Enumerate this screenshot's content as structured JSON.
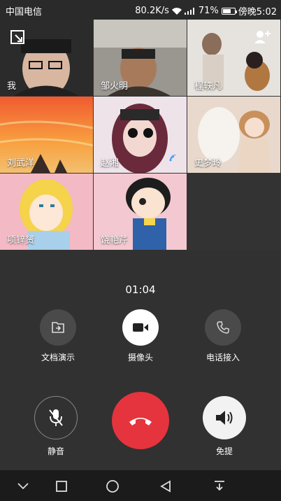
{
  "status": {
    "carrier": "中国电信",
    "speed": "80.2K/s",
    "battery_pct": "71%",
    "time": "傍晚5:02",
    "battery_level": 0.71
  },
  "participants": [
    {
      "name": "我"
    },
    {
      "name": "邹火明"
    },
    {
      "name": "程轶凡"
    },
    {
      "name": "刘武洋"
    },
    {
      "name": "赵湘"
    },
    {
      "name": "史梦玲"
    },
    {
      "name": "项锌赟"
    },
    {
      "name": "饶艳芹"
    }
  ],
  "call": {
    "timer": "01:04"
  },
  "actions": {
    "doc": "文档演示",
    "camera": "摄像头",
    "phone": "电话接入"
  },
  "controls": {
    "mute": "静音",
    "speaker": "免提"
  },
  "colors": {
    "hangup": "#e5343d",
    "background": "#313131"
  }
}
